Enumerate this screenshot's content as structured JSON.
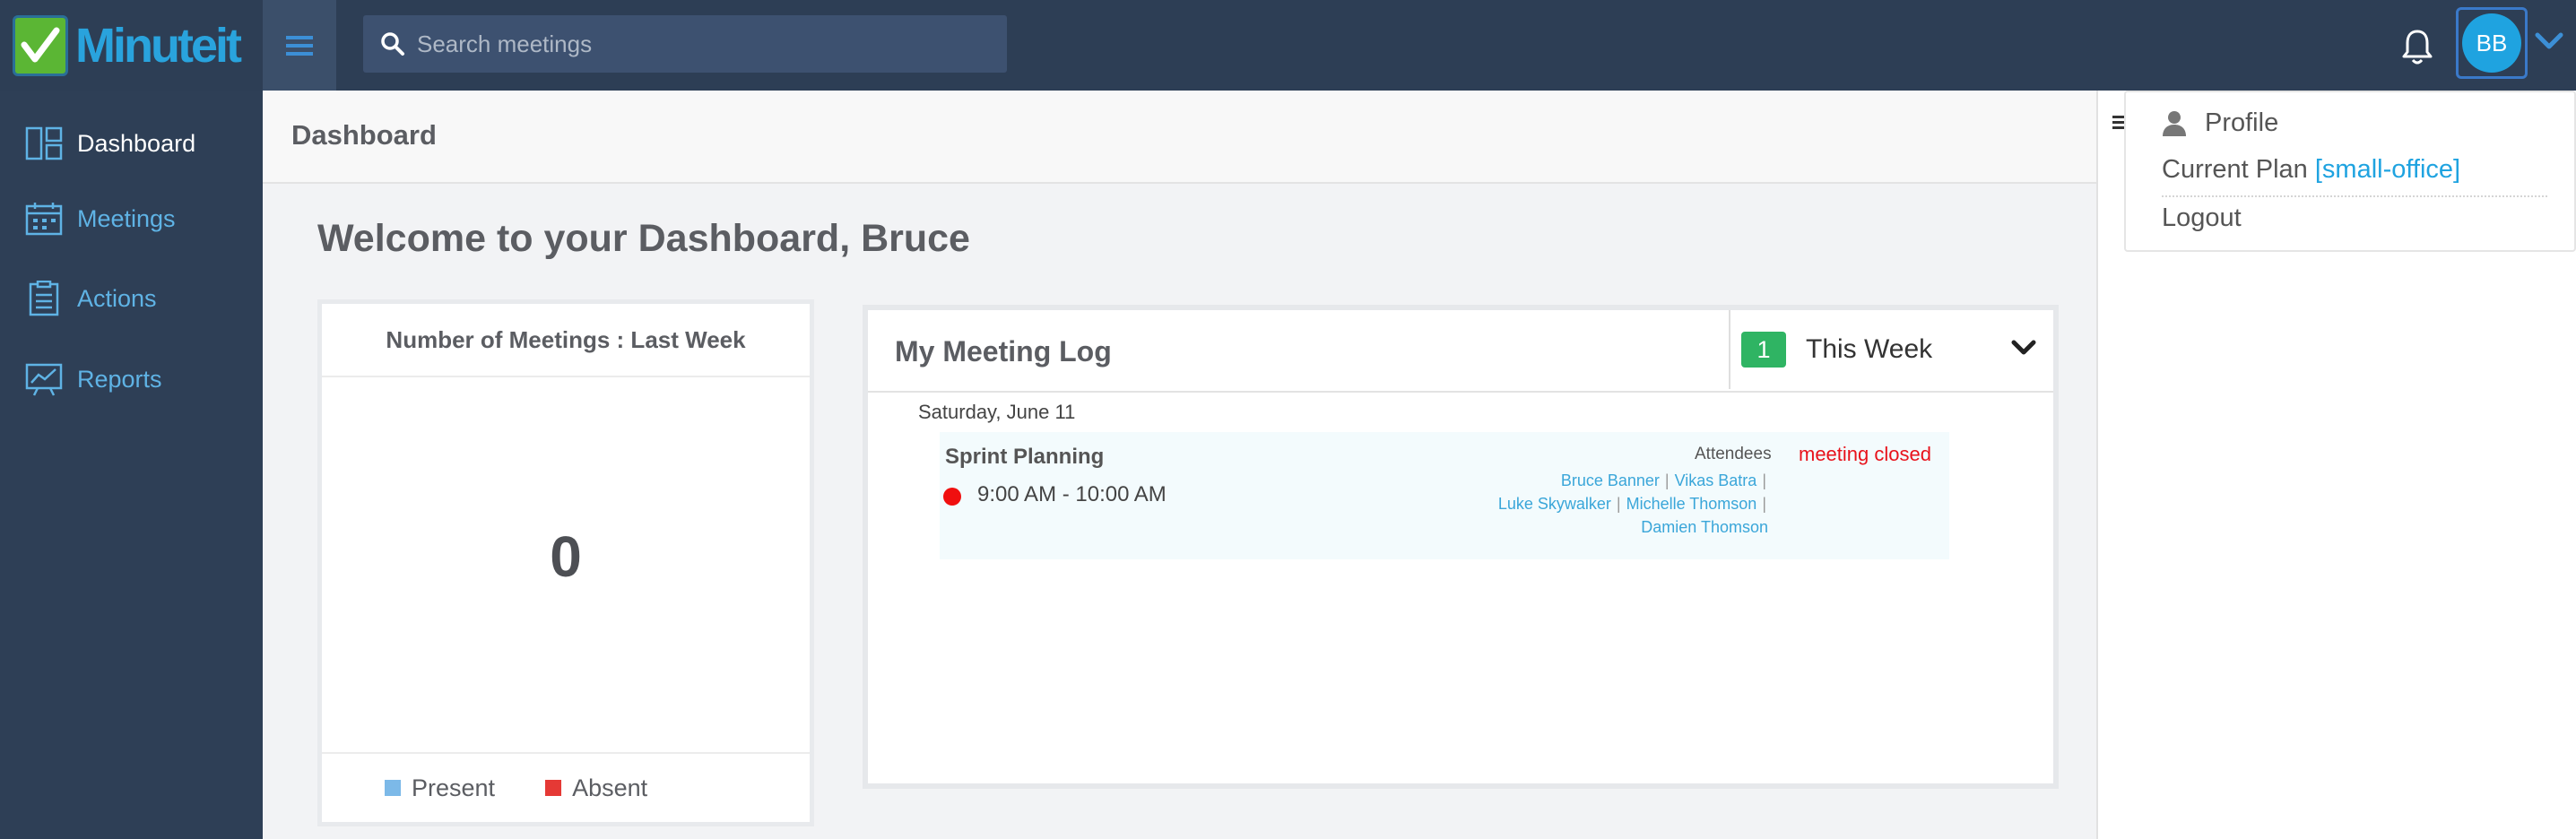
{
  "app": {
    "logo_text": "Minuteit"
  },
  "search": {
    "placeholder": "Search meetings"
  },
  "user": {
    "initials": "BB"
  },
  "user_menu": {
    "profile": "Profile",
    "plan_label": "Current Plan",
    "plan_value": "[small-office]",
    "logout": "Logout"
  },
  "sidebar": {
    "items": [
      {
        "label": "Dashboard",
        "icon": "dashboard-icon"
      },
      {
        "label": "Meetings",
        "icon": "calendar-icon"
      },
      {
        "label": "Actions",
        "icon": "clipboard-icon"
      },
      {
        "label": "Reports",
        "icon": "chart-icon"
      }
    ]
  },
  "page": {
    "title": "Dashboard",
    "welcome": "Welcome to your Dashboard, Bruce"
  },
  "meetings_card": {
    "title": "Number of Meetings : Last Week",
    "value": "0",
    "legend": [
      {
        "label": "Present",
        "color": "#7cb9e8"
      },
      {
        "label": "Absent",
        "color": "#e53935"
      }
    ]
  },
  "meeting_log": {
    "title": "My Meeting Log",
    "count": "1",
    "filter": "This Week",
    "date": "Saturday, June 11",
    "entry": {
      "title": "Sprint Planning",
      "time": "9:00 AM - 10:00 AM",
      "attendees_label": "Attendees",
      "status": "meeting closed",
      "attendees": [
        "Bruce Banner",
        "Vikas Batra",
        "Luke Skywalker",
        "Michelle Thomson",
        "Damien Thomson"
      ]
    }
  },
  "colors": {
    "topbar": "#2d3e55",
    "sidebar": "#2e3f56",
    "accent": "#1fa3e0",
    "badge_green": "#2fb463",
    "status_red": "#e8121b"
  }
}
